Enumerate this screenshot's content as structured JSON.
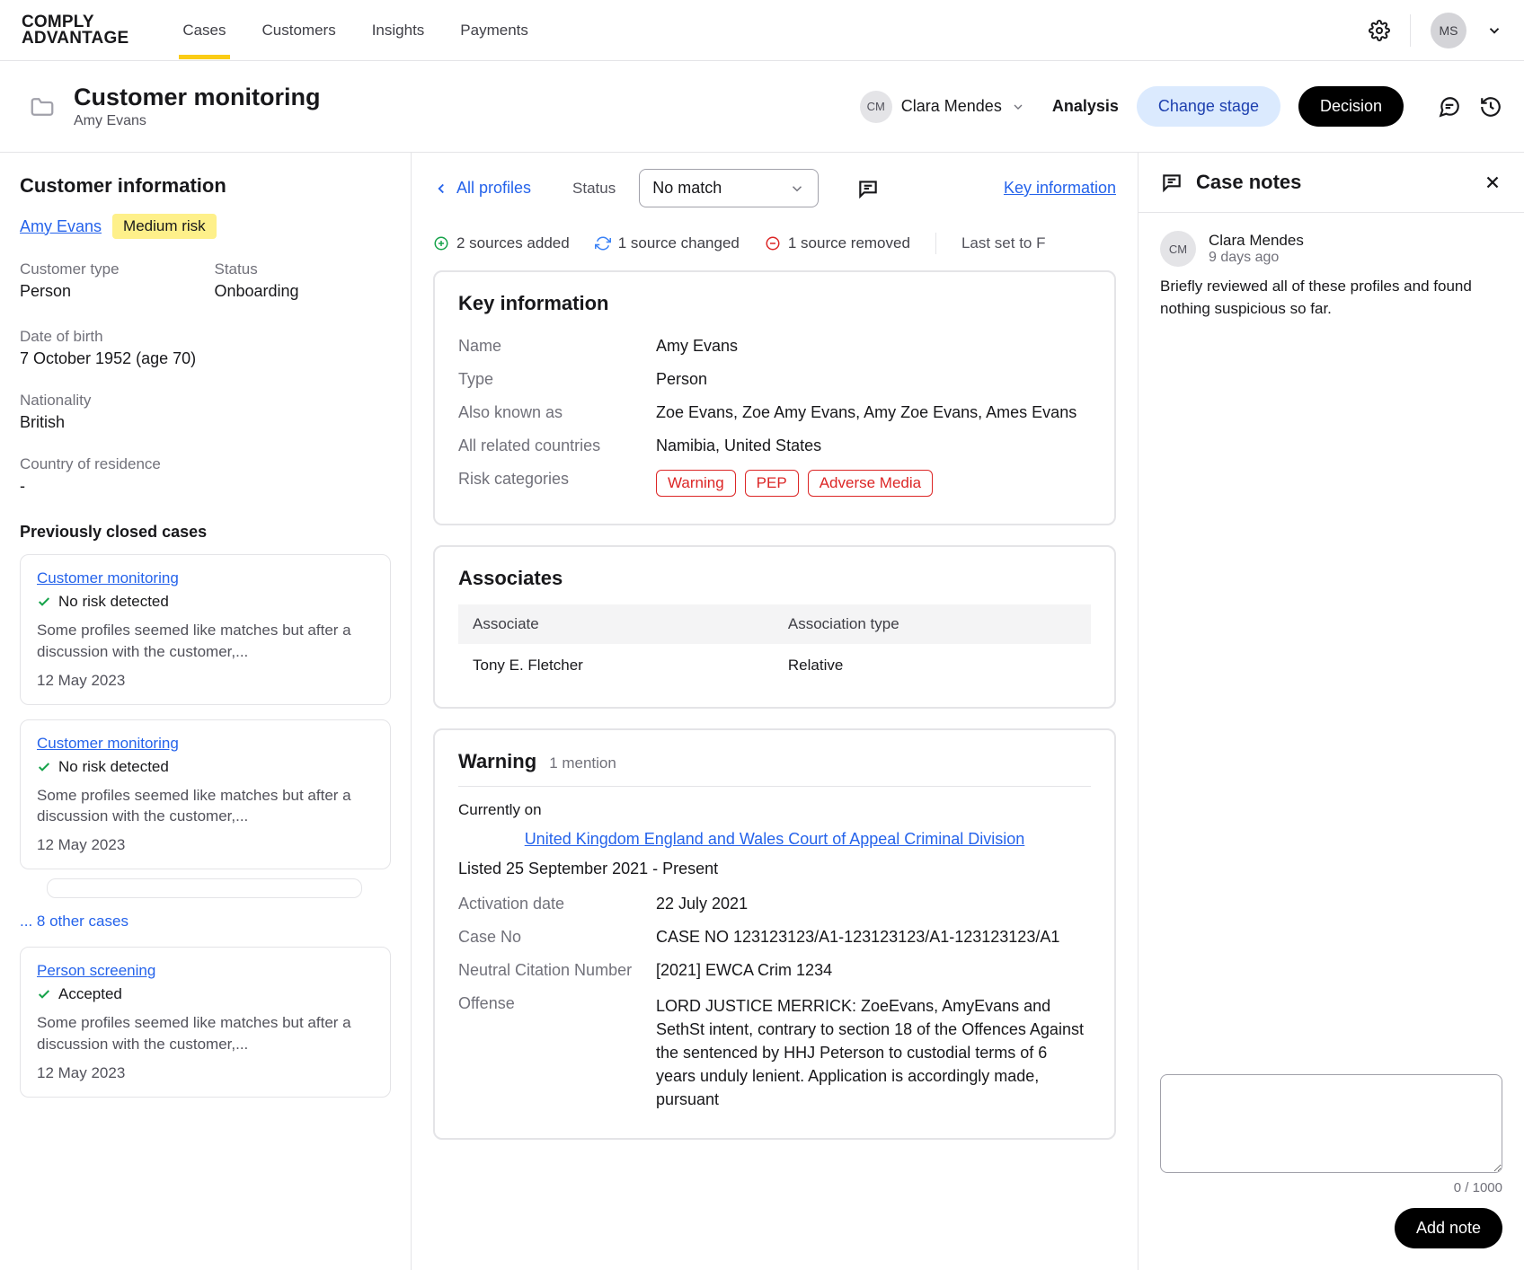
{
  "brand": {
    "line1": "COMPLY",
    "line2": "ADVANTAGE"
  },
  "nav": {
    "items": [
      "Cases",
      "Customers",
      "Insights",
      "Payments"
    ],
    "active": "Cases"
  },
  "user": {
    "initials": "MS"
  },
  "header": {
    "title": "Customer monitoring",
    "subtitle": "Amy Evans",
    "assignee": {
      "initials": "CM",
      "name": "Clara Mendes"
    },
    "analysis_label": "Analysis",
    "change_stage_label": "Change stage",
    "decision_label": "Decision"
  },
  "customer_info": {
    "title": "Customer information",
    "name": "Amy Evans",
    "risk_badge": "Medium risk",
    "fields": [
      {
        "label": "Customer type",
        "value": "Person"
      },
      {
        "label": "Status",
        "value": "Onboarding"
      },
      {
        "label": "Date of birth",
        "value": "7 October 1952 (age 70)",
        "full": true
      },
      {
        "label": "Nationality",
        "value": "British",
        "full": true
      },
      {
        "label": "Country of residence",
        "value": "-",
        "full": true
      }
    ],
    "prev_cases_title": "Previously closed cases",
    "prev_cases": [
      {
        "title": "Customer monitoring",
        "status": "No risk detected",
        "desc": "Some profiles seemed like matches but after a discussion with the customer,...",
        "date": "12 May 2023"
      },
      {
        "title": "Customer monitoring",
        "status": "No risk detected",
        "desc": "Some profiles seemed like matches but after a discussion with the customer,...",
        "date": "12 May 2023"
      }
    ],
    "more_cases": "... 8 other cases",
    "closed_case_single": {
      "title": "Person screening",
      "status": "Accepted",
      "desc": "Some profiles seemed like matches but after a discussion with the customer,...",
      "date": "12 May 2023"
    }
  },
  "mid": {
    "back_label": "All profiles",
    "status_label": "Status",
    "status_value": "No match",
    "key_info_link": "Key information",
    "changes": {
      "added": "2 sources added",
      "changed": "1 source changed",
      "removed": "1 source removed",
      "last_set": "Last set to F"
    },
    "key_info": {
      "title": "Key information",
      "rows": [
        {
          "k": "Name",
          "v": "Amy Evans"
        },
        {
          "k": "Type",
          "v": "Person"
        },
        {
          "k": "Also known as",
          "v": "Zoe Evans, Zoe Amy Evans, Amy Zoe Evans, Ames Evans"
        },
        {
          "k": "All related countries",
          "v": "Namibia, United States"
        }
      ],
      "risk_row_label": "Risk categories",
      "risk_tags": [
        "Warning",
        "PEP",
        "Adverse Media"
      ]
    },
    "associates": {
      "title": "Associates",
      "head": [
        "Associate",
        "Association type"
      ],
      "rows": [
        [
          "Tony E. Fletcher",
          "Relative"
        ]
      ]
    },
    "warning": {
      "title": "Warning",
      "mentions": "1 mention",
      "currently_on": "Currently on",
      "court": "United Kingdom England and Wales Court of Appeal Criminal Division",
      "listed": "Listed 25 September 2021 - Present",
      "rows": [
        {
          "k": "Activation date",
          "v": "22 July 2021"
        },
        {
          "k": "Case No",
          "v": "CASE NO 123123123/A1-123123123/A1-123123123/A1"
        },
        {
          "k": "Neutral Citation Number",
          "v": "[2021] EWCA Crim 1234"
        }
      ],
      "offense_label": "Offense",
      "offense_text": "LORD JUSTICE MERRICK: ZoeEvans, AmyEvans and SethSt intent, contrary to section 18 of the Offences Against the sentenced by HHJ Peterson to custodial terms of 6 years unduly lenient. Application is accordingly made, pursuant"
    }
  },
  "notes": {
    "title": "Case notes",
    "items": [
      {
        "initials": "CM",
        "author": "Clara Mendes",
        "when": "9 days ago",
        "text": "Briefly reviewed all of these profiles and found nothing suspicious so far."
      }
    ],
    "char_count": "0 / 1000",
    "add_label": "Add note"
  }
}
